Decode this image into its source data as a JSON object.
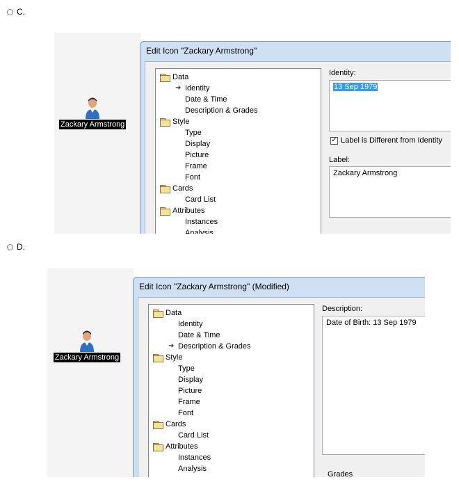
{
  "options": [
    {
      "letter": "C."
    },
    {
      "letter": "D."
    }
  ],
  "panelC": {
    "person_label": "Zackary Armstrong",
    "dialog_title": "Edit Icon \"Zackary Armstrong\"",
    "tree": [
      {
        "label": "Data",
        "type": "folder"
      },
      {
        "label": "Identity",
        "type": "child",
        "selected": true
      },
      {
        "label": "Date & Time",
        "type": "child"
      },
      {
        "label": "Description & Grades",
        "type": "child"
      },
      {
        "label": "Style",
        "type": "folder"
      },
      {
        "label": "Type",
        "type": "child"
      },
      {
        "label": "Display",
        "type": "child"
      },
      {
        "label": "Picture",
        "type": "child"
      },
      {
        "label": "Frame",
        "type": "child"
      },
      {
        "label": "Font",
        "type": "child"
      },
      {
        "label": "Cards",
        "type": "folder"
      },
      {
        "label": "Card List",
        "type": "child"
      },
      {
        "label": "Attributes",
        "type": "folder"
      },
      {
        "label": "Instances",
        "type": "child"
      },
      {
        "label": "Analysis",
        "type": "child"
      }
    ],
    "identity_label": "Identity:",
    "identity_value": "13 Sep 1979",
    "checkbox_label": "Label is Different from Identity",
    "checkbox_checked": true,
    "label_label": "Label:",
    "label_value": "Zackary Armstrong"
  },
  "panelD": {
    "person_label": "Zackary Armstrong",
    "dialog_title": "Edit Icon \"Zackary Armstrong\" (Modified)",
    "tree": [
      {
        "label": "Data",
        "type": "folder"
      },
      {
        "label": "Identity",
        "type": "child"
      },
      {
        "label": "Date & Time",
        "type": "child"
      },
      {
        "label": "Description & Grades",
        "type": "child",
        "selected": true
      },
      {
        "label": "Style",
        "type": "folder"
      },
      {
        "label": "Type",
        "type": "child"
      },
      {
        "label": "Display",
        "type": "child"
      },
      {
        "label": "Picture",
        "type": "child"
      },
      {
        "label": "Frame",
        "type": "child"
      },
      {
        "label": "Font",
        "type": "child"
      },
      {
        "label": "Cards",
        "type": "folder"
      },
      {
        "label": "Card List",
        "type": "child"
      },
      {
        "label": "Attributes",
        "type": "folder"
      },
      {
        "label": "Instances",
        "type": "child"
      },
      {
        "label": "Analysis",
        "type": "child"
      }
    ],
    "description_label": "Description:",
    "description_value": "Date of Birth: 13 Sep 1979",
    "grades_label": "Grades"
  },
  "colors": {
    "dialog_frame": "#cfe0f3",
    "selection": "#3399ff",
    "label_bg": "#000000"
  }
}
